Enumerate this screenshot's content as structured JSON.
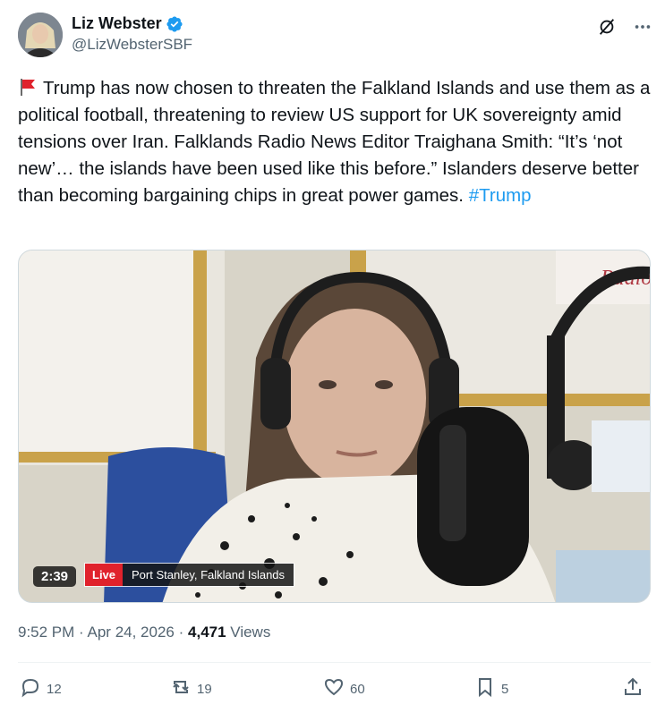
{
  "author": {
    "display_name": "Liz Webster",
    "handle": "@LizWebsterSBF",
    "verified": true
  },
  "tweet": {
    "text_main": "Trump has now chosen to threaten the Falkland Islands and use them as a political football, threatening to review US support for UK sovereignty amid tensions over Iran. Falklands Radio News Editor Traighana Smith: “It’s ‘not new’… the islands have been used like this before.” Islanders deserve better than becoming bargaining chips in great power games.",
    "hashtag": "#Trump",
    "leading_emoji": "red-flag"
  },
  "video": {
    "duration": "2:39",
    "live_label": "Live",
    "location": "Port Stanley, Falkland Islands",
    "background_sign_text": "Radio"
  },
  "meta": {
    "time": "9:52 PM",
    "separator": "·",
    "date": "Apr 24, 2026",
    "views_count": "4,471",
    "views_label": "Views"
  },
  "actions": {
    "replies": "12",
    "reposts": "19",
    "likes": "60",
    "bookmarks": "5"
  },
  "colors": {
    "accent": "#1d9bf0",
    "text": "#0f1419",
    "secondary": "#536471",
    "live_red": "#e0222c"
  }
}
